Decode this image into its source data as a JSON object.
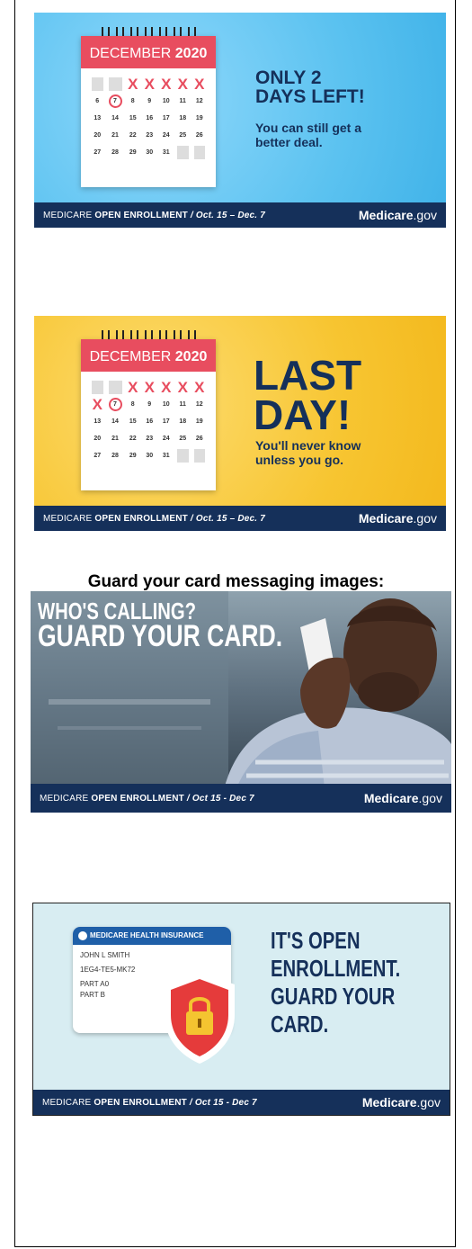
{
  "section_title": "Guard your card messaging images:",
  "banners": [
    {
      "month": "DECEMBER",
      "year": "2020",
      "headline_line1": "ONLY 2",
      "headline_line2": "DAYS LEFT!",
      "sub_line1": "You can still get a",
      "sub_line2": "better deal.",
      "bg_color": "#5bc2f0"
    },
    {
      "month": "DECEMBER",
      "year": "2020",
      "headline_line1": "LAST",
      "headline_line2": "DAY!",
      "sub_line1": "You'll never know",
      "sub_line2": "unless you go.",
      "bg_color": "#f7c531"
    },
    {
      "headline_line1": "WHO'S CALLING?",
      "headline_line2": "GUARD YOUR CARD."
    },
    {
      "card_header": "MEDICARE HEALTH INSURANCE",
      "card_name": "JOHN L SMITH",
      "card_number": "1EG4-TE5-MK72",
      "card_part_a": "PART A0",
      "card_part_b": "PART B",
      "headline_line1": "IT'S OPEN",
      "headline_line2": "ENROLLMENT.",
      "headline_line3": "GUARD YOUR",
      "headline_line4": "CARD."
    }
  ],
  "footer": {
    "medicare": "MEDICARE",
    "open_enrollment": "OPEN ENROLLMENT",
    "dates_long": "/ Oct. 15 – Dec. 7",
    "dates_short": "/ Oct 15 - Dec 7",
    "brand": "Medicare",
    "domain": ".gov"
  },
  "calendar_days": {
    "row1": [
      "",
      "",
      "X",
      "X",
      "X",
      "X",
      "X"
    ],
    "row2": [
      "6",
      "7",
      "8",
      "9",
      "10",
      "11",
      "12"
    ],
    "row3": [
      "13",
      "14",
      "15",
      "16",
      "17",
      "18",
      "19"
    ],
    "row4": [
      "20",
      "21",
      "22",
      "23",
      "24",
      "25",
      "26"
    ],
    "row5": [
      "27",
      "28",
      "29",
      "30",
      "31",
      "",
      ""
    ]
  }
}
